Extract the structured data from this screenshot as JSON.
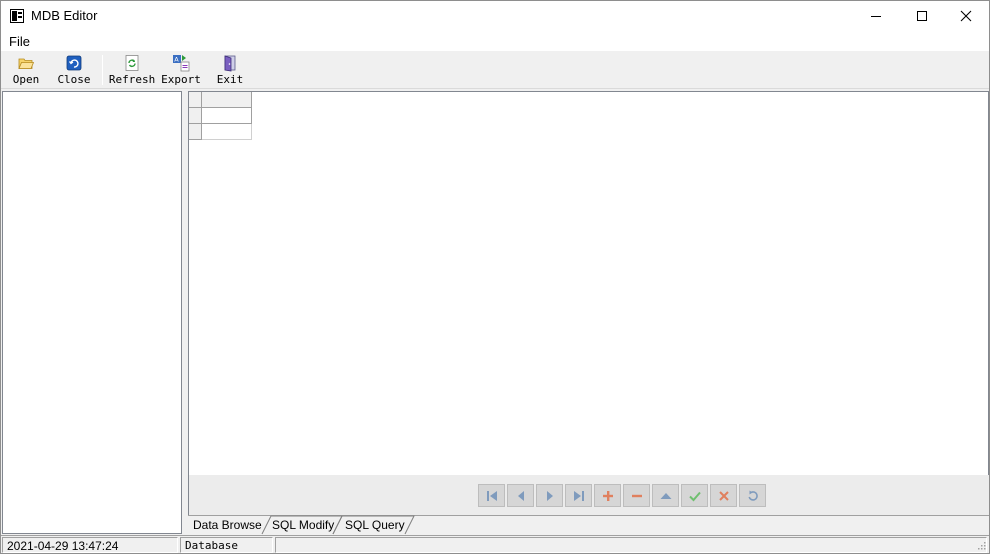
{
  "window": {
    "title": "MDB Editor"
  },
  "menu": {
    "file": "File"
  },
  "toolbar": {
    "open": "Open",
    "close": "Close",
    "refresh": "Refresh",
    "export": "Export",
    "exit": "Exit"
  },
  "tabs": [
    {
      "label": "Data Browse",
      "active": true
    },
    {
      "label": "SQL Modify",
      "active": false
    },
    {
      "label": "SQL Query",
      "active": false
    }
  ],
  "status": {
    "datetime": "2021-04-29 13:47:24",
    "database_label": "Database Name:",
    "database_value": ""
  },
  "colors": {
    "nav_green": "#4fb24f",
    "nav_red": "#d24f3c",
    "nav_blue": "#5f88b4"
  }
}
